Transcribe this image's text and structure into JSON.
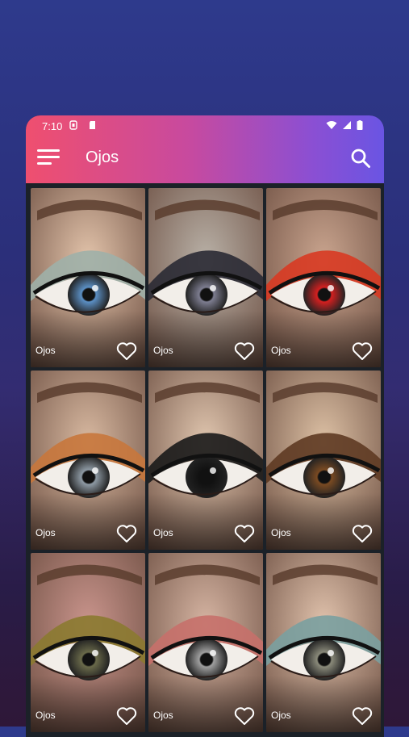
{
  "status": {
    "time": "7:10"
  },
  "appbar": {
    "title": "Ojos"
  },
  "cards": [
    {
      "label": "Ojos",
      "theme": "cat",
      "iris": "#5b8fc4",
      "shadow": "#9fb0a8",
      "skin": "#e2c3aa"
    },
    {
      "label": "Ojos",
      "theme": "ghost",
      "iris": "#7d7d90",
      "shadow": "#2a2a34",
      "skin": "#b8b0a6"
    },
    {
      "label": "Ojos",
      "theme": "chain",
      "iris": "#d42020",
      "shadow": "#d83a22",
      "skin": "#c9a48e"
    },
    {
      "label": "Ojos",
      "theme": "bat",
      "iris": "#8e9aa4",
      "shadow": "#c8773c",
      "skin": "#d7b8a0"
    },
    {
      "label": "Ojos",
      "theme": "pumpkin",
      "iris": "#111111",
      "shadow": "#1a1a1a",
      "skin": "#dfc5ae"
    },
    {
      "label": "Ojos",
      "theme": "tree",
      "iris": "#7a4a22",
      "shadow": "#5e3a22",
      "skin": "#dcc0a4"
    },
    {
      "label": "Ojos",
      "theme": "glitter",
      "iris": "#6a6a4a",
      "shadow": "#8b7a30",
      "skin": "#c9948c"
    },
    {
      "label": "Ojos",
      "theme": "stitch",
      "iris": "#a0a0a0",
      "shadow": "#c7706a",
      "skin": "#d5b4a2"
    },
    {
      "label": "Ojos",
      "theme": "bones",
      "iris": "#8a8a7a",
      "shadow": "#7aa0a0",
      "skin": "#e0c2ac"
    }
  ]
}
